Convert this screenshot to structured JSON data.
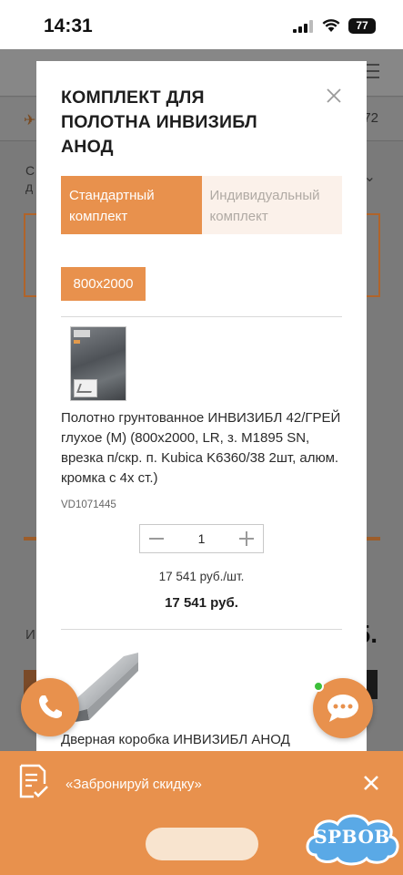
{
  "status_bar": {
    "time": "14:31",
    "battery": "77"
  },
  "background": {
    "order_number_fragment": "72",
    "text_fragment_a": "С\nд",
    "text_fragment_b": "И",
    "price_fragment": "5."
  },
  "modal": {
    "title": "КОМПЛЕКТ ДЛЯ ПОЛОТНА ИНВИЗИБЛ АНОД",
    "tabs": [
      {
        "label": "Стандартный комплект",
        "active": true
      },
      {
        "label": "Индивидуальный комплект",
        "active": false
      }
    ],
    "size_option": "800x2000",
    "items": [
      {
        "name": "Полотно грунтованное ИНВИЗИБЛ 42/ГРЕЙ глухое (М) (800x2000, LR, з. М1895 SN, врезка п/скр. п. Kubica K6360/38 2шт, алюм. кромка с 4х ст.)",
        "code": "VD1071445",
        "quantity": "1",
        "unit_price": "17 541 руб./шт.",
        "total_price": "17 541 руб."
      },
      {
        "name": "Дверная коробка ИНВИЗИБЛ АНОД"
      }
    ]
  },
  "promo": {
    "text": "«Забронируй скидку»"
  },
  "watermark": {
    "text": "SPBOB"
  },
  "colors": {
    "accent": "#e8914d",
    "accent_light": "#fbf1ea",
    "online_dot": "#3cbf3a"
  }
}
